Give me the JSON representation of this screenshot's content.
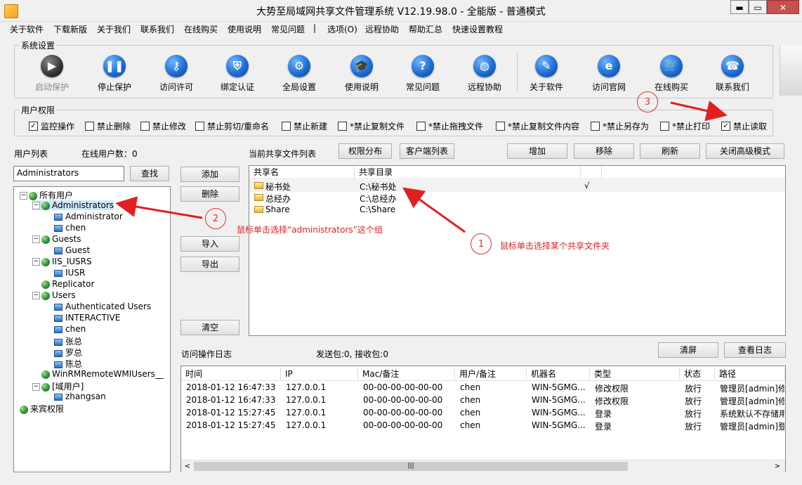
{
  "window": {
    "title": "大势至局域网共享文件管理系统 V12.19.98.0 - 全能版 - 普通模式",
    "minimize": "▬",
    "maximize": "▭",
    "close": "✕"
  },
  "menu": [
    "关于软件",
    "下载新版",
    "关于我们",
    "联系我们",
    "在线购买",
    "使用说明",
    "常见问题",
    "|",
    "选项(O)",
    "远程协助",
    "帮助汇总",
    "快速设置教程"
  ],
  "system_settings": {
    "title": "系统设置",
    "buttons": [
      {
        "label": "启动保护",
        "icon": "play-icon",
        "glyph": "▶",
        "disabled": true
      },
      {
        "label": "停止保护",
        "icon": "pause-icon",
        "glyph": "❚❚",
        "disabled": false
      },
      {
        "label": "访问许可",
        "icon": "key-icon",
        "glyph": "⚷",
        "disabled": false
      },
      {
        "label": "绑定认证",
        "icon": "shield-icon",
        "glyph": "⛨",
        "disabled": false
      },
      {
        "label": "全局设置",
        "icon": "gear-icon",
        "glyph": "⚙",
        "disabled": false
      },
      {
        "label": "使用说明",
        "icon": "graduation-cap-icon",
        "glyph": "🎓",
        "disabled": false
      },
      {
        "label": "常见问题",
        "icon": "question-icon",
        "glyph": "?",
        "disabled": false
      },
      {
        "label": "远程协助",
        "icon": "globe-icon",
        "glyph": "◍",
        "disabled": false
      },
      {
        "label": "关于软件",
        "icon": "document-icon",
        "glyph": "✎",
        "disabled": false
      },
      {
        "label": "访问官网",
        "icon": "browser-icon",
        "glyph": "e",
        "disabled": false
      },
      {
        "label": "在线购买",
        "icon": "cart-icon",
        "glyph": "🛒",
        "disabled": false
      },
      {
        "label": "联系我们",
        "icon": "phone-icon",
        "glyph": "☎",
        "disabled": false
      }
    ]
  },
  "user_permissions": {
    "title": "用户权限",
    "options": [
      {
        "label": "监控操作",
        "checked": true
      },
      {
        "label": "禁止删除",
        "checked": false
      },
      {
        "label": "禁止修改",
        "checked": false
      },
      {
        "label": "禁止剪切/重命名",
        "checked": false
      },
      {
        "label": "禁止新建",
        "checked": false
      },
      {
        "label": "*禁止复制文件",
        "checked": false
      },
      {
        "label": "*禁止拖拽文件",
        "checked": false
      },
      {
        "label": "*禁止复制文件内容",
        "checked": false
      },
      {
        "label": "*禁止另存为",
        "checked": false
      },
      {
        "label": "*禁止打印",
        "checked": false
      },
      {
        "label": "禁止读取",
        "checked": true
      }
    ]
  },
  "user_list": {
    "label": "用户列表",
    "online_label": "在线用户数：0",
    "search_value": "Administrators",
    "search_button": "查找",
    "tree": [
      {
        "text": "所有用户",
        "level": 0,
        "type": "globe",
        "expander": "⊟"
      },
      {
        "text": "Administrators",
        "level": 1,
        "type": "globe",
        "expander": "⊟",
        "selected": true
      },
      {
        "text": "Administrator",
        "level": 2,
        "type": "user"
      },
      {
        "text": "chen",
        "level": 2,
        "type": "user"
      },
      {
        "text": "Guests",
        "level": 1,
        "type": "globe",
        "expander": "⊟"
      },
      {
        "text": "Guest",
        "level": 2,
        "type": "user"
      },
      {
        "text": "IIS_IUSRS",
        "level": 1,
        "type": "globe",
        "expander": "⊟"
      },
      {
        "text": "IUSR",
        "level": 2,
        "type": "user"
      },
      {
        "text": "Replicator",
        "level": 1,
        "type": "globe"
      },
      {
        "text": "Users",
        "level": 1,
        "type": "globe",
        "expander": "⊟"
      },
      {
        "text": "Authenticated Users",
        "level": 2,
        "type": "user"
      },
      {
        "text": "INTERACTIVE",
        "level": 2,
        "type": "user"
      },
      {
        "text": "chen",
        "level": 2,
        "type": "user"
      },
      {
        "text": "张总",
        "level": 2,
        "type": "user"
      },
      {
        "text": "罗总",
        "level": 2,
        "type": "user"
      },
      {
        "text": "陈总",
        "level": 2,
        "type": "user"
      },
      {
        "text": "WinRMRemoteWMIUsers__",
        "level": 1,
        "type": "globe"
      },
      {
        "text": "[域用户]",
        "level": 1,
        "type": "globe",
        "expander": "⊟"
      },
      {
        "text": "zhangsan",
        "level": 2,
        "type": "user"
      },
      {
        "text": "来宾权限",
        "level": 0,
        "type": "globe"
      }
    ]
  },
  "middle_buttons": {
    "add": "添加",
    "delete": "删除",
    "import": "导入",
    "export": "导出",
    "clear": "清空"
  },
  "share_list": {
    "label": "当前共享文件列表",
    "perm_dist_button": "权限分布",
    "client_list_button": "客户端列表",
    "add_button": "增加",
    "remove_button": "移除",
    "refresh_button": "刷新",
    "close_advanced_button": "关闭高级模式",
    "columns": [
      "共享名",
      "共享目录",
      ""
    ],
    "rows": [
      {
        "name": "秘书处",
        "path": "C:\\秘书处",
        "mark": "√"
      },
      {
        "name": "总经办",
        "path": "C:\\总经办",
        "mark": ""
      },
      {
        "name": "Share",
        "path": "C:\\Share",
        "mark": ""
      }
    ]
  },
  "log": {
    "label": "访问操作日志",
    "stats": "发送包:0, 接收包:0",
    "clear_button": "清屏",
    "view_button": "查看日志",
    "columns": [
      "时间",
      "IP",
      "Mac/备注",
      "用户/备注",
      "机器名",
      "类型",
      "状态",
      "路径"
    ],
    "rows": [
      [
        "2018-01-12 16:47:33",
        "127.0.0.1",
        "00-00-00-00-00-00",
        "chen",
        "WIN-5GMG...",
        "修改权限",
        "放行",
        "管理员[admin]修"
      ],
      [
        "2018-01-12 16:47:33",
        "127.0.0.1",
        "00-00-00-00-00-00",
        "chen",
        "WIN-5GMG...",
        "修改权限",
        "放行",
        "管理员[admin]修"
      ],
      [
        "2018-01-12 15:27:45",
        "127.0.0.1",
        "00-00-00-00-00-00",
        "chen",
        "WIN-5GMG...",
        "登录",
        "放行",
        "系统默认不存储用"
      ],
      [
        "2018-01-12 15:27:45",
        "127.0.0.1",
        "00-00-00-00-00-00",
        "chen",
        "WIN-5GMG...",
        "登录",
        "放行",
        "管理员[admin]登"
      ]
    ],
    "scroll_left": "<",
    "scroll_right": ">",
    "scroll_thumb": "|||"
  },
  "annotations": {
    "step1_num": "1",
    "step1_text": "鼠标单击选择某个共享文件夹",
    "step2_num": "2",
    "step2_text": "鼠标单击选择“administrators”这个组",
    "step3_num": "3"
  },
  "colors": {
    "accent": "#1e6fd4",
    "annotation": "#e02020",
    "selection": "#cce8ff"
  }
}
